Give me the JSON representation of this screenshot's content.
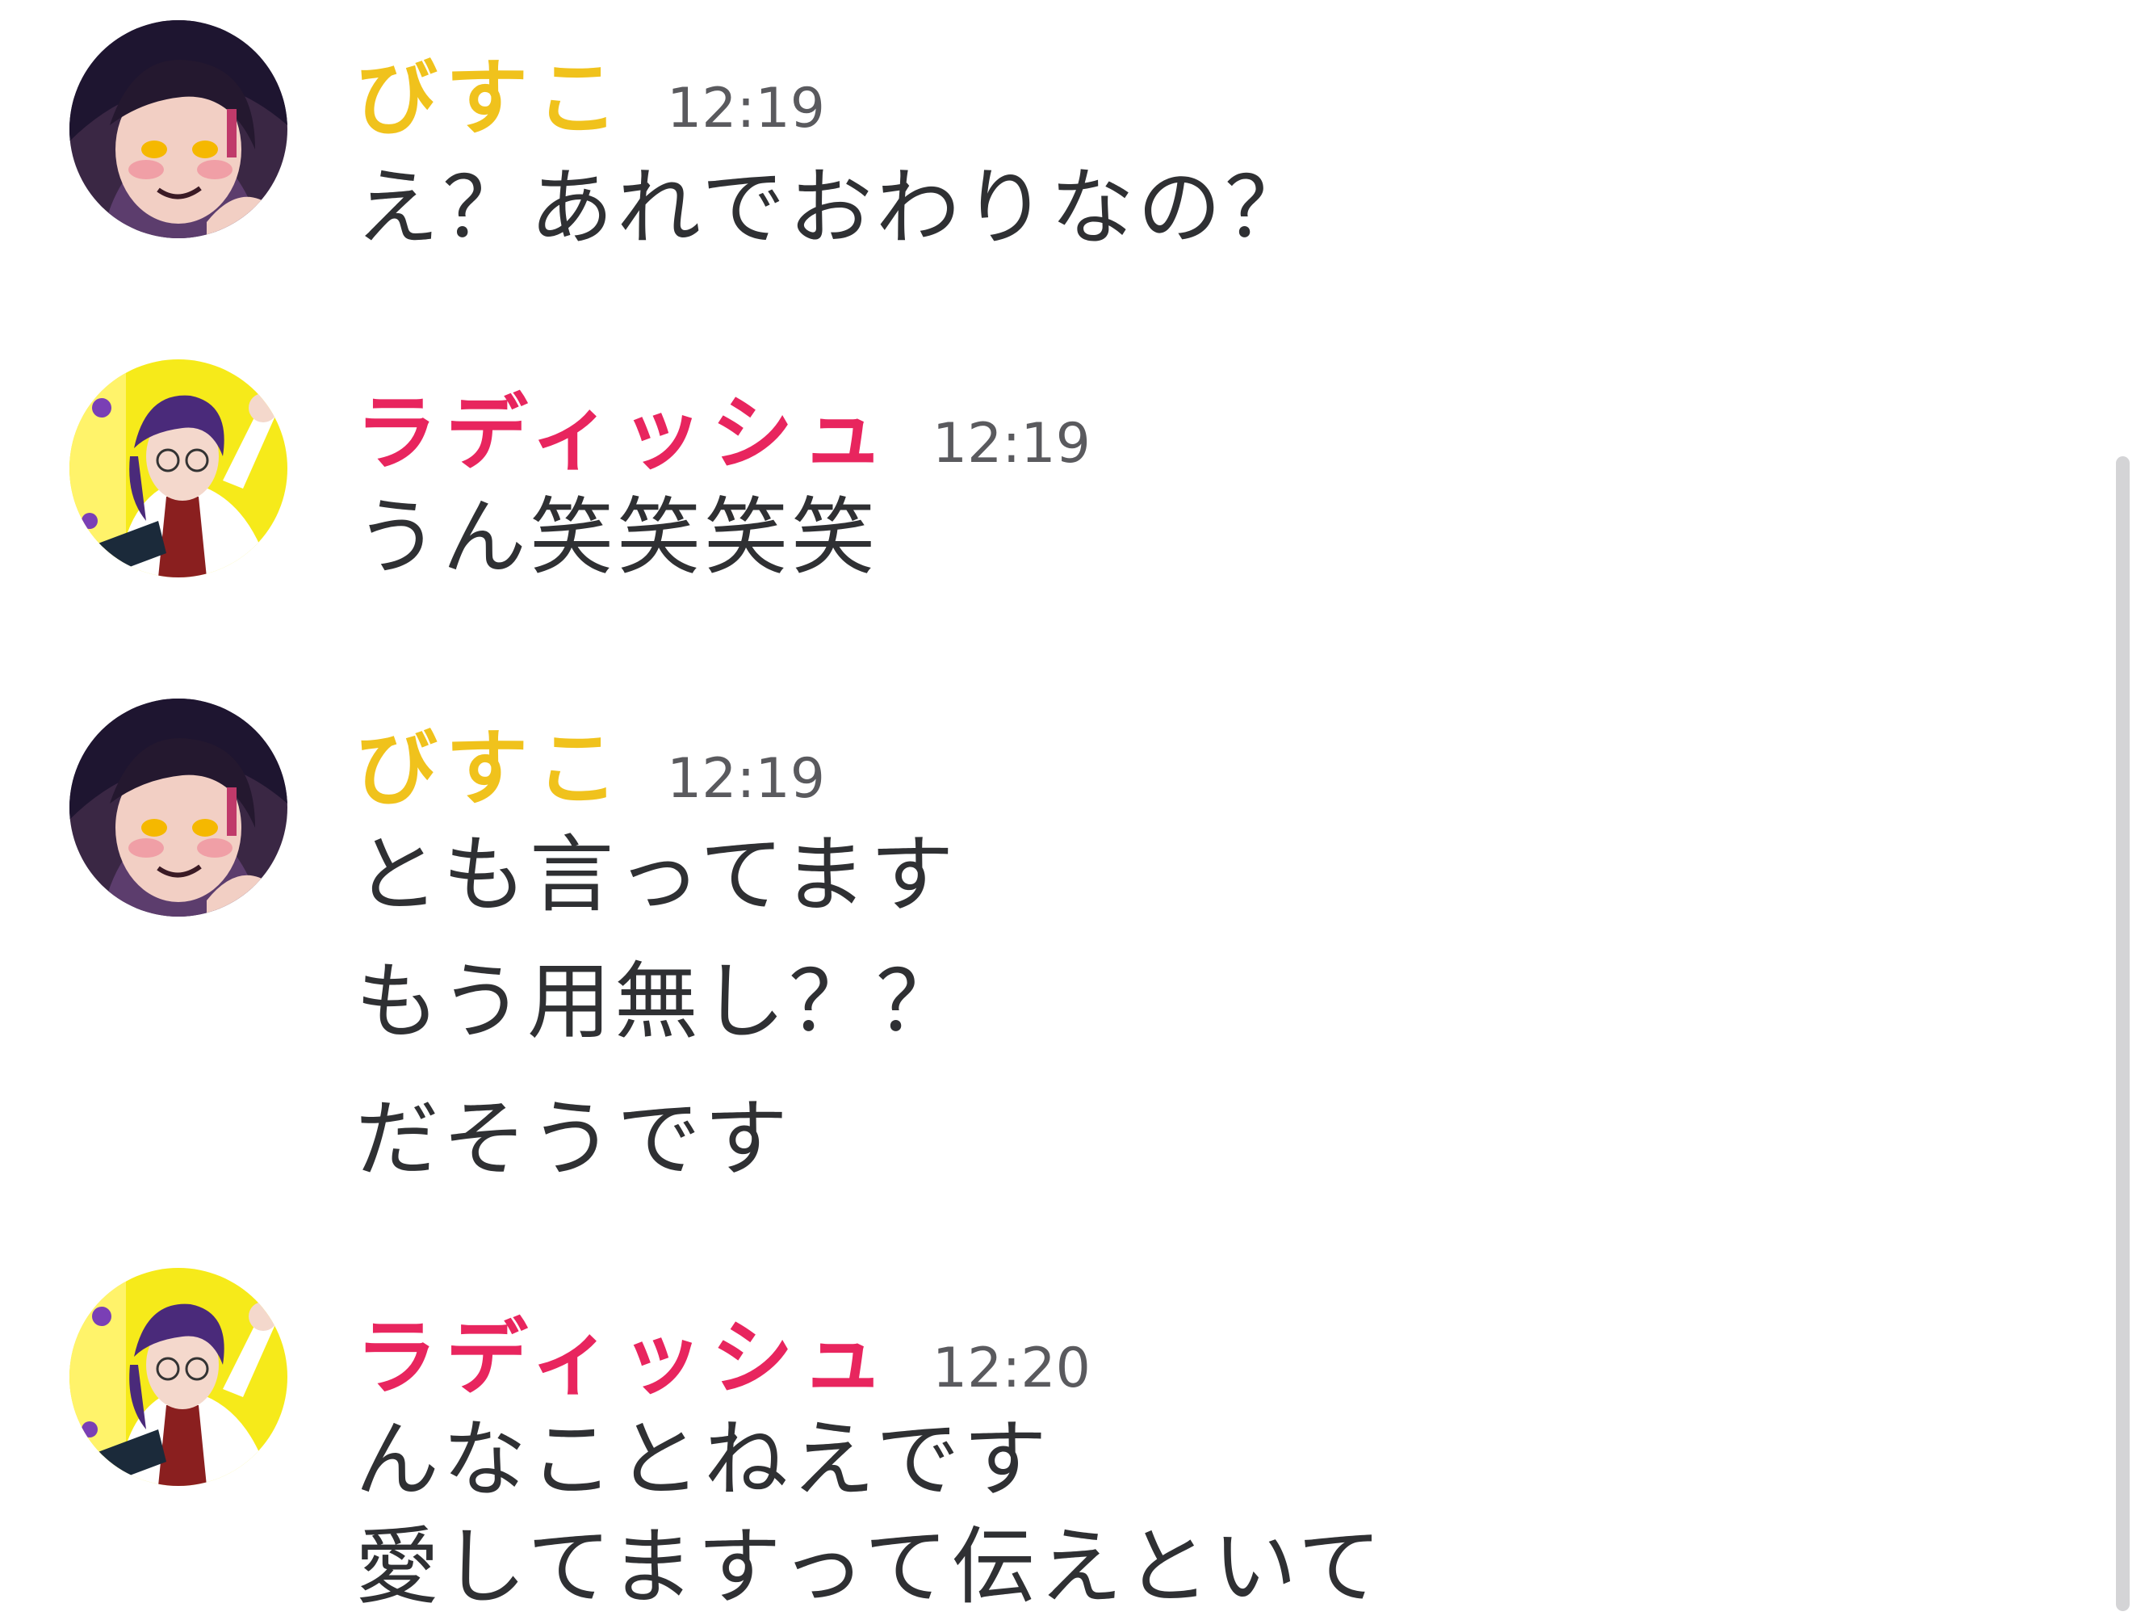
{
  "colors": {
    "bisuko_name": "#f0c21c",
    "radish_name": "#e8255e",
    "message_text": "#2f3033",
    "timestamp": "#5a5a5e"
  },
  "messages": [
    {
      "author": "びすこ",
      "time": "12:19",
      "avatar": "bisuko-avatar",
      "lines": [
        "え？あれでおわりなの？"
      ]
    },
    {
      "author": "ラディッシュ",
      "time": "12:19",
      "avatar": "radish-avatar",
      "lines": [
        "うん笑笑笑笑"
      ]
    },
    {
      "author": "びすこ",
      "time": "12:19",
      "avatar": "bisuko-avatar",
      "lines": [
        "とも言ってます",
        "もう用無し？？",
        "だそうです"
      ]
    },
    {
      "author": "ラディッシュ",
      "time": "12:20",
      "avatar": "radish-avatar",
      "lines": [
        "んなことねえです",
        "愛してますって伝えといて"
      ]
    }
  ]
}
